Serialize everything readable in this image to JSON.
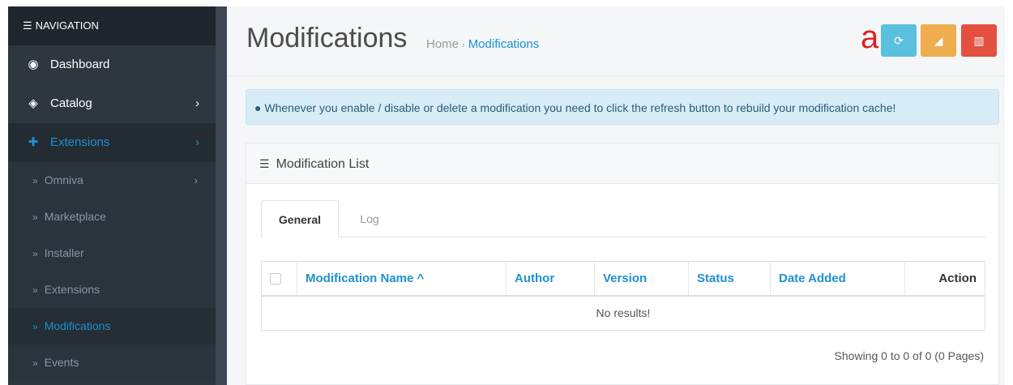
{
  "sidebar": {
    "header": "NAVIGATION",
    "items": [
      {
        "label": "Dashboard"
      },
      {
        "label": "Catalog"
      },
      {
        "label": "Extensions"
      }
    ],
    "sub_items": [
      {
        "label": "Omniva"
      },
      {
        "label": "Marketplace"
      },
      {
        "label": "Installer"
      },
      {
        "label": "Extensions"
      },
      {
        "label": "Modifications"
      },
      {
        "label": "Events"
      }
    ]
  },
  "header": {
    "title": "Modifications",
    "breadcrumb": [
      "Home",
      "Modifications"
    ],
    "mark": "a"
  },
  "alert": {
    "text": "Whenever you enable / disable or delete a modification you need to click the refresh button to rebuild your modification cache!"
  },
  "panel": {
    "title": "Modification List",
    "tabs": [
      "General",
      "Log"
    ],
    "columns": [
      "Modification Name ^",
      "Author",
      "Version",
      "Status",
      "Date Added",
      "Action"
    ],
    "empty": "No results!",
    "pagination": "Showing 0 to 0 of 0 (0 Pages)"
  },
  "colors": {
    "accent": "#1e91cf",
    "refresh": "#5bc0de",
    "clear": "#f0ad4e",
    "delete": "#e3503e"
  }
}
